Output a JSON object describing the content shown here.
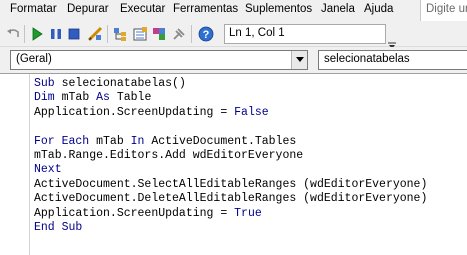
{
  "menu": {
    "items": [
      "Formatar",
      "Depurar",
      "Executar",
      "Ferramentas",
      "Suplementos",
      "Janela",
      "Ajuda"
    ],
    "help_placeholder": "Digite um"
  },
  "toolbar": {
    "icons": [
      "undo-icon",
      "run-icon",
      "break-icon",
      "reset-icon",
      "design-mode-icon",
      "project-explorer-icon",
      "properties-icon",
      "object-browser-icon",
      "toolbox-icon",
      "help-icon"
    ],
    "position": "Ln 1, Col 1"
  },
  "object_combo": {
    "value": "(Geral)"
  },
  "procedure_combo": {
    "value": "selecionatabelas"
  },
  "colors": {
    "keyword": "#00008b",
    "text": "#000000",
    "chrome": "#f0f0f0"
  },
  "code": {
    "lines": [
      {
        "keyword": "Sub",
        "text": " selecionatabelas()"
      },
      {
        "keyword": "Dim",
        "text": " mTab ",
        "keyword2": "As",
        "text2": " Table"
      },
      {
        "keyword": "",
        "text": "Application.ScreenUpdating = ",
        "keyword2": "False",
        "text2": ""
      },
      {
        "keyword": "",
        "text": ""
      },
      {
        "keyword": "For Each",
        "text": " mTab ",
        "keyword2": "In",
        "text2": " ActiveDocument.Tables"
      },
      {
        "keyword": "",
        "text": "mTab.Range.Editors.Add wdEditorEveryone"
      },
      {
        "keyword": "Next",
        "text": ""
      },
      {
        "keyword": "",
        "text": "ActiveDocument.SelectAllEditableRanges (wdEditorEveryone)"
      },
      {
        "keyword": "",
        "text": "ActiveDocument.DeleteAllEditableRanges (wdEditorEveryone)"
      },
      {
        "keyword": "",
        "text": "Application.ScreenUpdating = ",
        "keyword2": "True",
        "text2": ""
      },
      {
        "keyword": "End Sub",
        "text": ""
      }
    ]
  }
}
